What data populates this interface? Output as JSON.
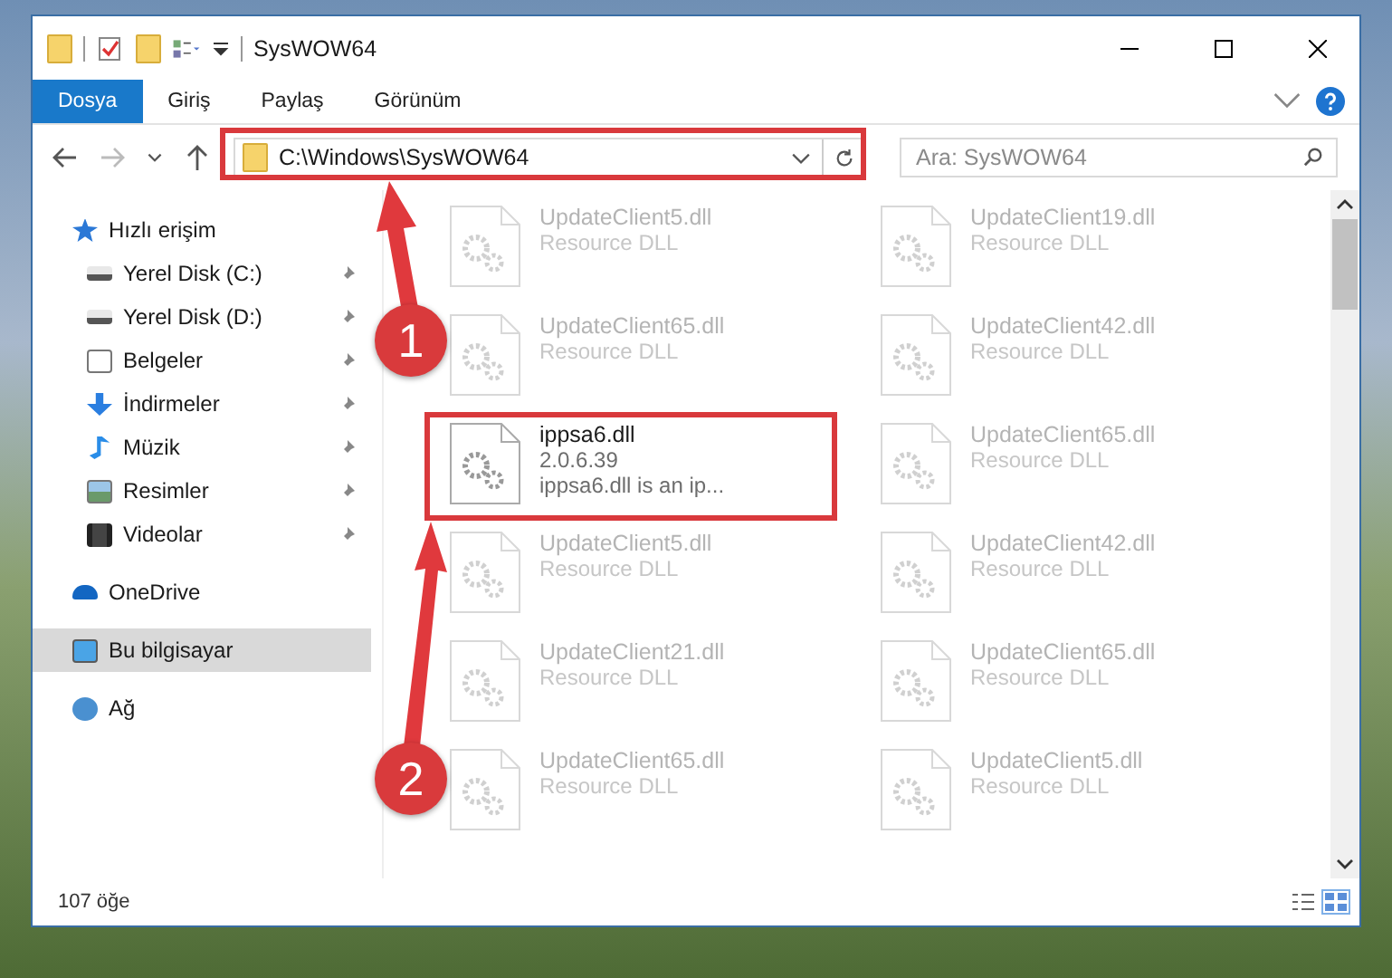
{
  "window": {
    "title": "SysWOW64"
  },
  "ribbon_tabs": [
    {
      "label": "Dosya",
      "selected": true
    },
    {
      "label": "Giriş",
      "selected": false
    },
    {
      "label": "Paylaş",
      "selected": false
    },
    {
      "label": "Görünüm",
      "selected": false
    }
  ],
  "address_bar": {
    "path": "C:\\Windows\\SysWOW64"
  },
  "search": {
    "placeholder": "Ara: SysWOW64"
  },
  "sidebar": {
    "items": [
      {
        "label": "Hızlı erişim",
        "kind": "star",
        "selected": false,
        "children": [
          {
            "label": "Yerel Disk (C:)",
            "kind": "drive",
            "pinned": true,
            "selected": false
          },
          {
            "label": "Yerel Disk (D:)",
            "kind": "drive",
            "pinned": true,
            "selected": false
          },
          {
            "label": "Belgeler",
            "kind": "document",
            "pinned": true,
            "selected": false
          },
          {
            "label": "İndirmeler",
            "kind": "download",
            "pinned": true,
            "selected": false
          },
          {
            "label": "Müzik",
            "kind": "music",
            "pinned": true,
            "selected": false
          },
          {
            "label": "Resimler",
            "kind": "picture",
            "pinned": true,
            "selected": false
          },
          {
            "label": "Videolar",
            "kind": "video",
            "pinned": true,
            "selected": false
          }
        ]
      },
      {
        "label": "OneDrive",
        "kind": "cloud",
        "selected": false
      },
      {
        "label": "Bu bilgisayar",
        "kind": "computer",
        "selected": true
      },
      {
        "label": "Ağ",
        "kind": "network",
        "selected": false
      }
    ]
  },
  "files": [
    {
      "name": "UpdateClient5.dll",
      "description": "Resource DLL",
      "faded": true
    },
    {
      "name": "UpdateClient19.dll",
      "description": "Resource DLL",
      "faded": true
    },
    {
      "name": "UpdateClient65.dll",
      "description": "Resource DLL",
      "faded": true
    },
    {
      "name": "UpdateClient42.dll",
      "description": "Resource DLL",
      "faded": true
    },
    {
      "name": "ippsa6.dll",
      "version": "2.0.6.39",
      "description": "ippsa6.dll is an ip...",
      "faded": false
    },
    {
      "name": "UpdateClient65.dll",
      "description": "Resource DLL",
      "faded": true
    },
    {
      "name": "UpdateClient5.dll",
      "description": "Resource DLL",
      "faded": true
    },
    {
      "name": "UpdateClient42.dll",
      "description": "Resource DLL",
      "faded": true
    },
    {
      "name": "UpdateClient21.dll",
      "description": "Resource DLL",
      "faded": true
    },
    {
      "name": "UpdateClient65.dll",
      "description": "Resource DLL",
      "faded": true
    },
    {
      "name": "UpdateClient65.dll",
      "description": "Resource DLL",
      "faded": true
    },
    {
      "name": "UpdateClient5.dll",
      "description": "Resource DLL",
      "faded": true
    }
  ],
  "status_bar": {
    "item_count": "107 öğe"
  },
  "annotations": [
    {
      "number": "1"
    },
    {
      "number": "2"
    }
  ]
}
